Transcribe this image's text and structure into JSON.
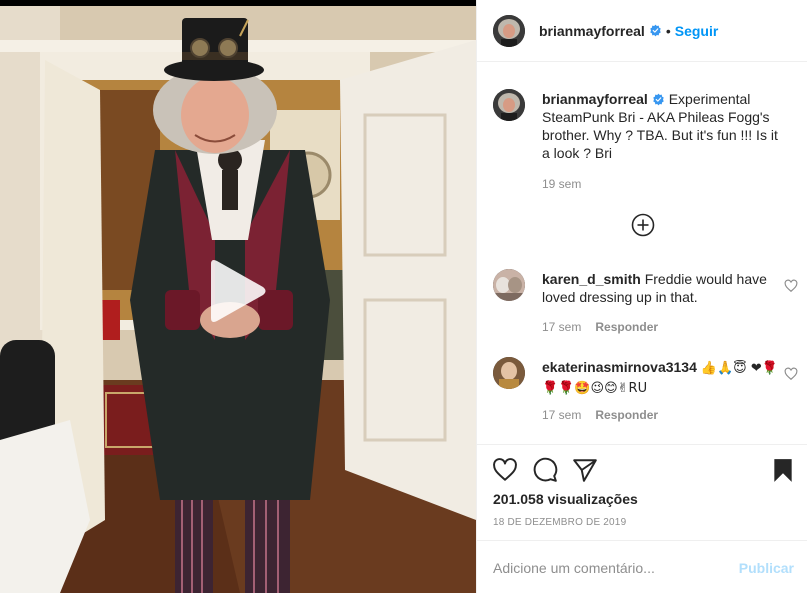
{
  "post": {
    "author": "brianmayforreal",
    "follow_label": "Seguir",
    "separator": "•",
    "caption": {
      "username": "brianmayforreal",
      "text": "Experimental SteamPunk Bri - AKA Phileas Fogg's brother. Why ? TBA. But it's fun !!! Is it a look ? Bri",
      "time": "19 sem"
    },
    "comments": [
      {
        "username": "karen_d_smith",
        "text": "Freddie would have loved dressing up in that.",
        "time": "17 sem",
        "reply_label": "Responder"
      },
      {
        "username": "ekaterinasmirnova3134",
        "text": "👍🙏😇 ❤🌹🌹🌹🤩😉😊✌RU",
        "time": "17 sem",
        "reply_label": "Responder"
      }
    ],
    "views": "201.058 visualizações",
    "date": "18 DE DEZEMBRO DE 2019",
    "add_comment": {
      "placeholder": "Adicione um comentário...",
      "publish_label": "Publicar"
    }
  },
  "icons": {
    "verified": "verified-badge-icon",
    "like": "heart-icon",
    "comment": "comment-bubble-icon",
    "share": "paper-plane-icon",
    "save": "bookmark-icon",
    "load_more": "plus-circle-icon",
    "play": "play-icon"
  },
  "colors": {
    "accent_blue": "#0095f6",
    "publish_disabled": "#b2dffc",
    "secondary_text": "#8e8e8e",
    "primary_text": "#262626"
  }
}
